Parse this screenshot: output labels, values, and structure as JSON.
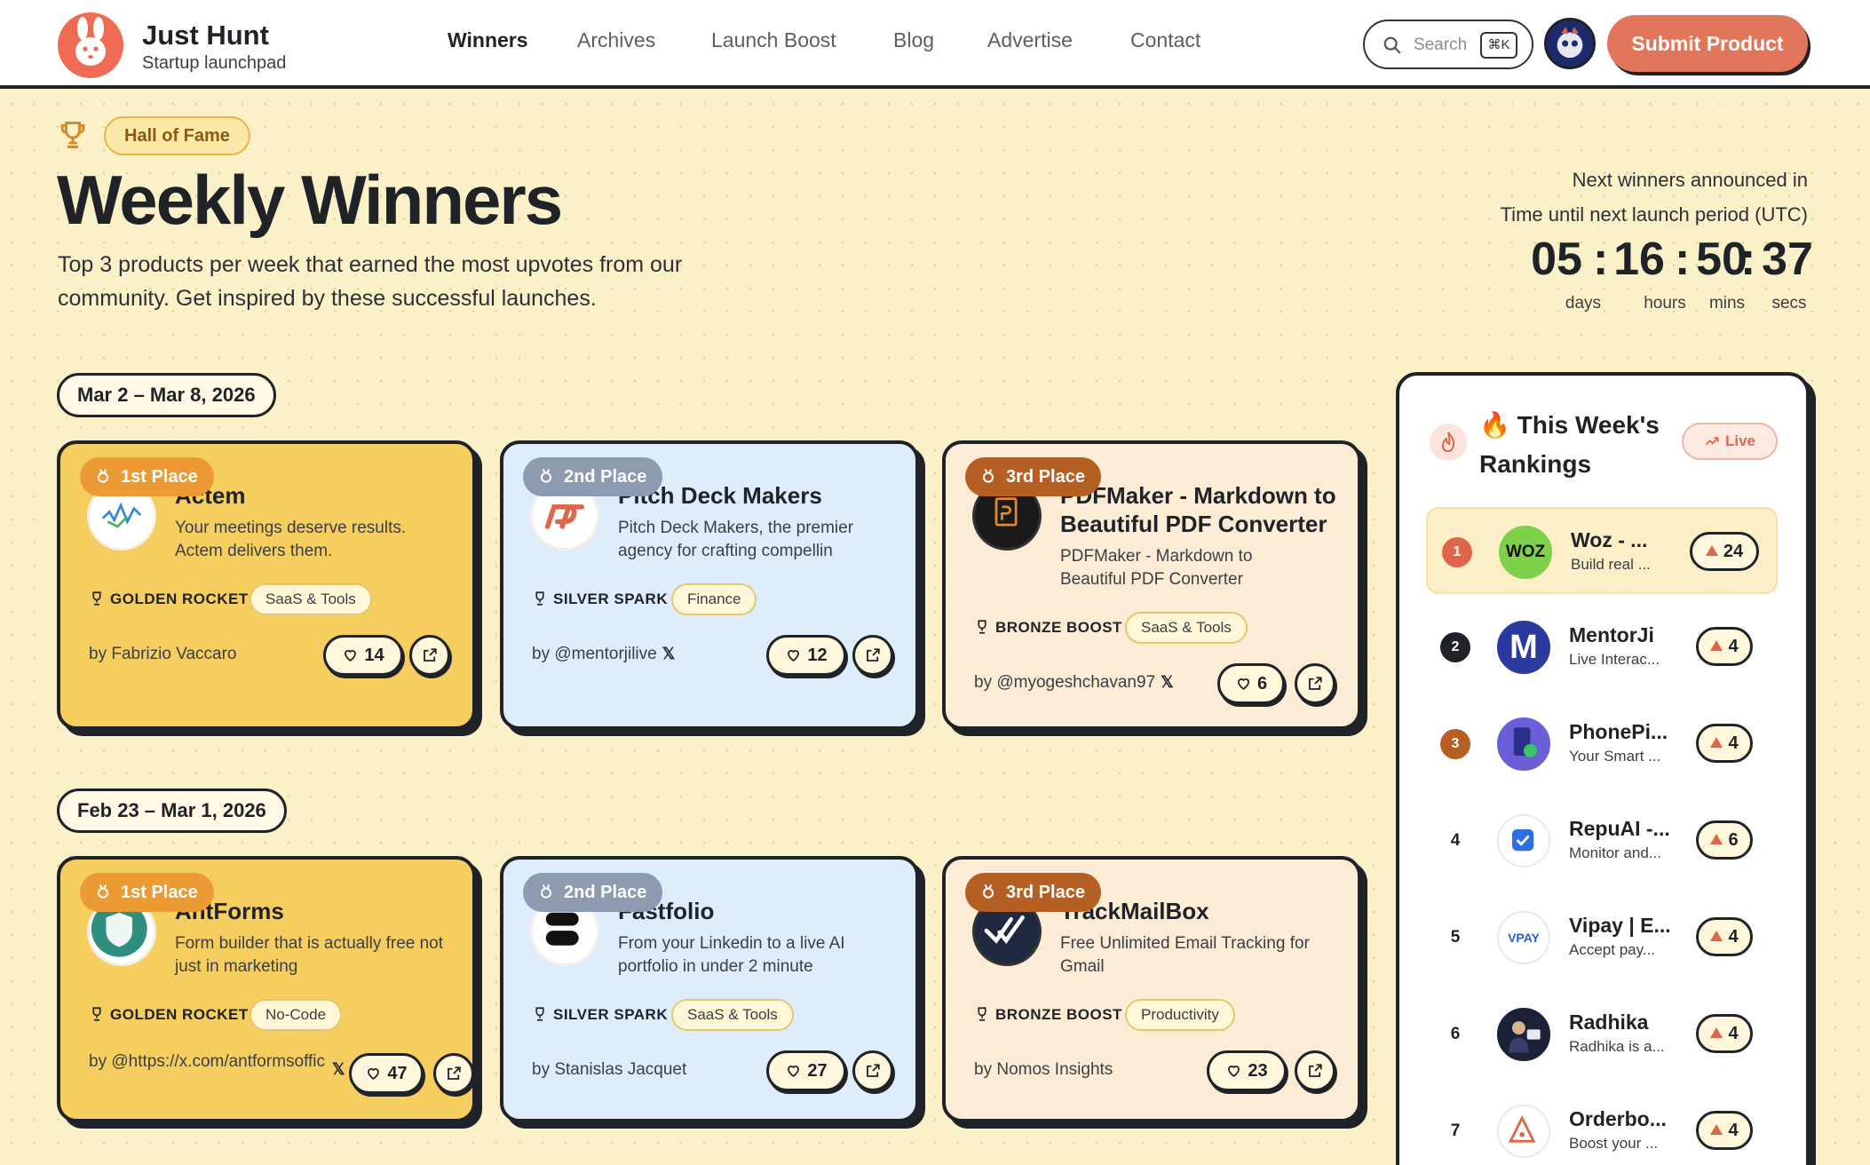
{
  "header": {
    "brand_name": "Just Hunt",
    "brand_tagline": "Startup launchpad",
    "nav": [
      "Winners",
      "Archives",
      "Launch Boost",
      "Blog",
      "Advertise",
      "Contact"
    ],
    "active_nav": "Winners",
    "search_placeholder": "Search",
    "search_shortcut": "⌘K",
    "submit_label": "Submit Product"
  },
  "hero": {
    "badge": "Hall of Fame",
    "title": "Weekly Winners",
    "subtitle": "Top 3 products per week that earned the most upvotes from our community. Get inspired by these successful launches.",
    "next_label": "Next winners announced in",
    "period_label": "Time until next launch period (UTC)",
    "countdown": {
      "days": "05",
      "hours": "16",
      "mins": "50",
      "secs": "37"
    },
    "countdown_labels": {
      "days": "days",
      "hours": "hours",
      "mins": "mins",
      "secs": "secs"
    }
  },
  "weeks": [
    {
      "label": "Mar 2 – Mar 8, 2026",
      "winners": [
        {
          "place": "1st Place",
          "name": "Actem",
          "desc": "Your meetings deserve results. Actem delivers them.",
          "award": "GOLDEN ROCKET",
          "tag": "SaaS & Tools",
          "by": "by Fabrizio Vaccaro",
          "votes": "14"
        },
        {
          "place": "2nd Place",
          "name": "Pitch Deck Makers",
          "desc": "Pitch Deck Makers, the premier agency for crafting compellin",
          "award": "SILVER SPARK",
          "tag": "Finance",
          "by": "by @mentorjilive",
          "votes": "12"
        },
        {
          "place": "3rd Place",
          "name": "PDFMaker - Markdown to Beautiful PDF Converter",
          "desc": "PDFMaker - Markdown to Beautiful PDF Converter",
          "award": "BRONZE BOOST",
          "tag": "SaaS & Tools",
          "by": "by @myogeshchavan97",
          "votes": "6"
        }
      ]
    },
    {
      "label": "Feb 23 – Mar 1, 2026",
      "winners": [
        {
          "place": "1st Place",
          "name": "AntForms",
          "desc": "Form builder that is actually free not just in marketing",
          "award": "GOLDEN ROCKET",
          "tag": "No-Code",
          "by": "by @https://x.com/antformsoffic",
          "votes": "47"
        },
        {
          "place": "2nd Place",
          "name": "Fastfolio",
          "desc": "From your Linkedin to a live AI portfolio in under 2 minute",
          "award": "SILVER SPARK",
          "tag": "SaaS & Tools",
          "by": "by Stanislas Jacquet",
          "votes": "27"
        },
        {
          "place": "3rd Place",
          "name": "TrackMailBox",
          "desc": "Free Unlimited Email Tracking for Gmail",
          "award": "BRONZE BOOST",
          "tag": "Productivity",
          "by": "by Nomos Insights",
          "votes": "23"
        }
      ]
    }
  ],
  "rankings": {
    "title": "🔥 This Week's Rankings",
    "live_label": "Live",
    "items": [
      {
        "rank": "1",
        "name": "Woz - ...",
        "desc": "Build real ...",
        "votes": "24"
      },
      {
        "rank": "2",
        "name": "MentorJi",
        "desc": "Live Interac...",
        "votes": "4"
      },
      {
        "rank": "3",
        "name": "PhonePi...",
        "desc": "Your Smart ...",
        "votes": "4"
      },
      {
        "rank": "4",
        "name": "RepuAI -...",
        "desc": "Monitor and...",
        "votes": "6"
      },
      {
        "rank": "5",
        "name": "Vipay | E...",
        "desc": "Accept pay...",
        "votes": "4"
      },
      {
        "rank": "6",
        "name": "Radhika",
        "desc": "Radhika is a...",
        "votes": "4"
      },
      {
        "rank": "7",
        "name": "Orderbo...",
        "desc": "Boost your ...",
        "votes": "4"
      }
    ]
  },
  "colors": {
    "accent": "#e2765b",
    "gold": "#f6cd5f",
    "silver_card": "#deecfb",
    "bronze_card": "#fcecd5",
    "page_bg": "#fbf1c9"
  },
  "icons": {
    "logo": "rabbit-logo",
    "search": "search-icon",
    "trophy": "trophy-icon",
    "medal": "medal-icon",
    "heart": "heart-icon",
    "external": "external-link-icon",
    "x": "x-logo-icon",
    "live": "trending-up-icon",
    "flame": "flame-icon"
  },
  "rank_logo_text": {
    "woz": "WOZ",
    "mentorji": "M",
    "vipay": "VPAY"
  }
}
